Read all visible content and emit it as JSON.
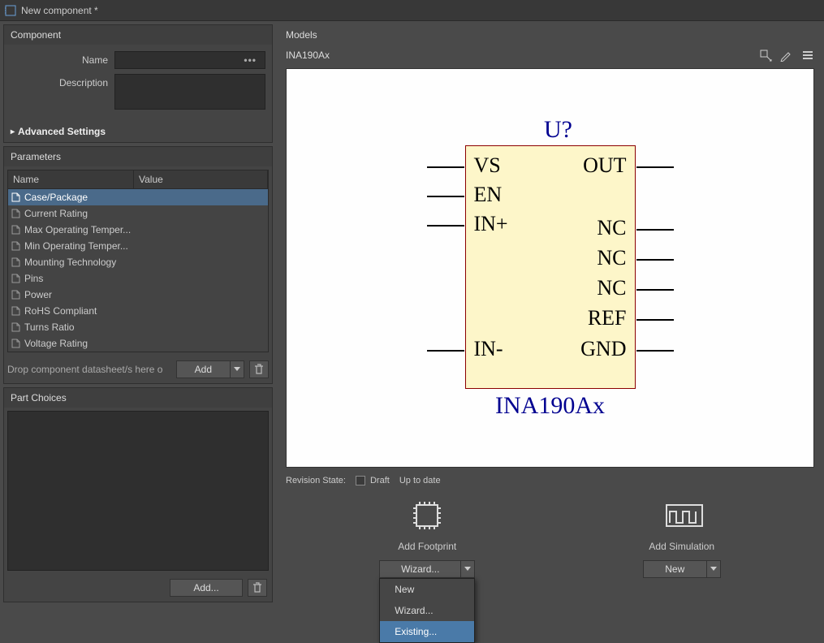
{
  "window": {
    "title": "New component *"
  },
  "component": {
    "header": "Component",
    "name_label": "Name",
    "name_value": "",
    "description_label": "Description",
    "description_value": "",
    "advanced_label": "Advanced Settings"
  },
  "parameters": {
    "header": "Parameters",
    "columns": {
      "name": "Name",
      "value": "Value"
    },
    "rows": [
      {
        "name": "Case/Package",
        "value": "",
        "selected": true
      },
      {
        "name": "Current Rating",
        "value": ""
      },
      {
        "name": "Max Operating Temper...",
        "value": ""
      },
      {
        "name": "Min Operating Temper...",
        "value": ""
      },
      {
        "name": "Mounting Technology",
        "value": ""
      },
      {
        "name": "Pins",
        "value": ""
      },
      {
        "name": "Power",
        "value": ""
      },
      {
        "name": "RoHS Compliant",
        "value": ""
      },
      {
        "name": "Turns Ratio",
        "value": ""
      },
      {
        "name": "Voltage Rating",
        "value": ""
      }
    ],
    "datasheet_hint": "Drop component datasheet/s here o",
    "add_button": "Add"
  },
  "part_choices": {
    "header": "Part Choices",
    "add_button": "Add..."
  },
  "models": {
    "header": "Models",
    "symbol_name": "INA190Ax",
    "revision_label": "Revision State:",
    "draft_label": "Draft",
    "uptodate_label": "Up to date",
    "footprint": {
      "label": "Add Footprint",
      "button": "Wizard...",
      "menu": [
        "New",
        "Wizard...",
        "Existing..."
      ],
      "highlighted_index": 2
    },
    "simulation": {
      "label": "Add Simulation",
      "button": "New"
    }
  },
  "schematic": {
    "designator": "U?",
    "part_name": "INA190Ax",
    "left_pins": [
      "VS",
      "EN",
      "IN+",
      "IN-"
    ],
    "right_pins": [
      "OUT",
      "NC",
      "NC",
      "NC",
      "REF",
      "GND"
    ]
  }
}
